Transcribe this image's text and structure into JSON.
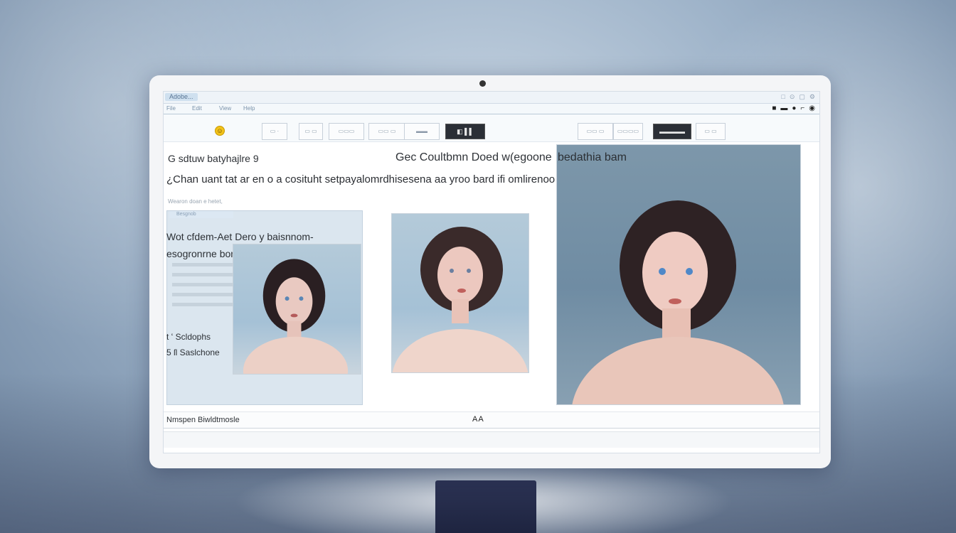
{
  "window": {
    "app_tag": "Adobe...",
    "controls": [
      "□",
      "⊙",
      "▢",
      "⚙"
    ]
  },
  "menubar": {
    "items": [
      "File",
      "Edit",
      "View",
      "Help"
    ],
    "tools": [
      "■",
      "▬",
      "●",
      "⌐",
      "◉"
    ]
  },
  "toolbar": {
    "buttons": [
      "▭ ·",
      "▭ ▭",
      "▭▭▭",
      "▭▭ ▭",
      "▬▬"
    ],
    "dark_button": "◧ ▌▌",
    "right_buttons": [
      "▭▭ ▭",
      "▭▭▭▭",
      "▭ ▭"
    ],
    "right_dark_button": "▬▬▬▬"
  },
  "main": {
    "heading_left": "G sdtuw batyhajlre 9",
    "heading_mid": "Gec Coultbmn Doed w(egoone",
    "description": "¿Chan uant tat ar en o a cosituht setpayalomrdhisesena aa yroo bard ifi omlirenoo a rwvanunowntir gnau",
    "hint": "Wearon doan e hetet,",
    "panel_tab": "Besgnob",
    "panel_text": "Wot cfdem-Aet Dero y baisnnom- esogronrne bonl.",
    "label_1": "t ʻ Scldophs",
    "label_2": "5 ſl Saslchone",
    "right_heading": "bedathia bam",
    "right_description": ""
  },
  "status": {
    "left": "Nmspen Biwldtmosle",
    "middle": "AA"
  }
}
